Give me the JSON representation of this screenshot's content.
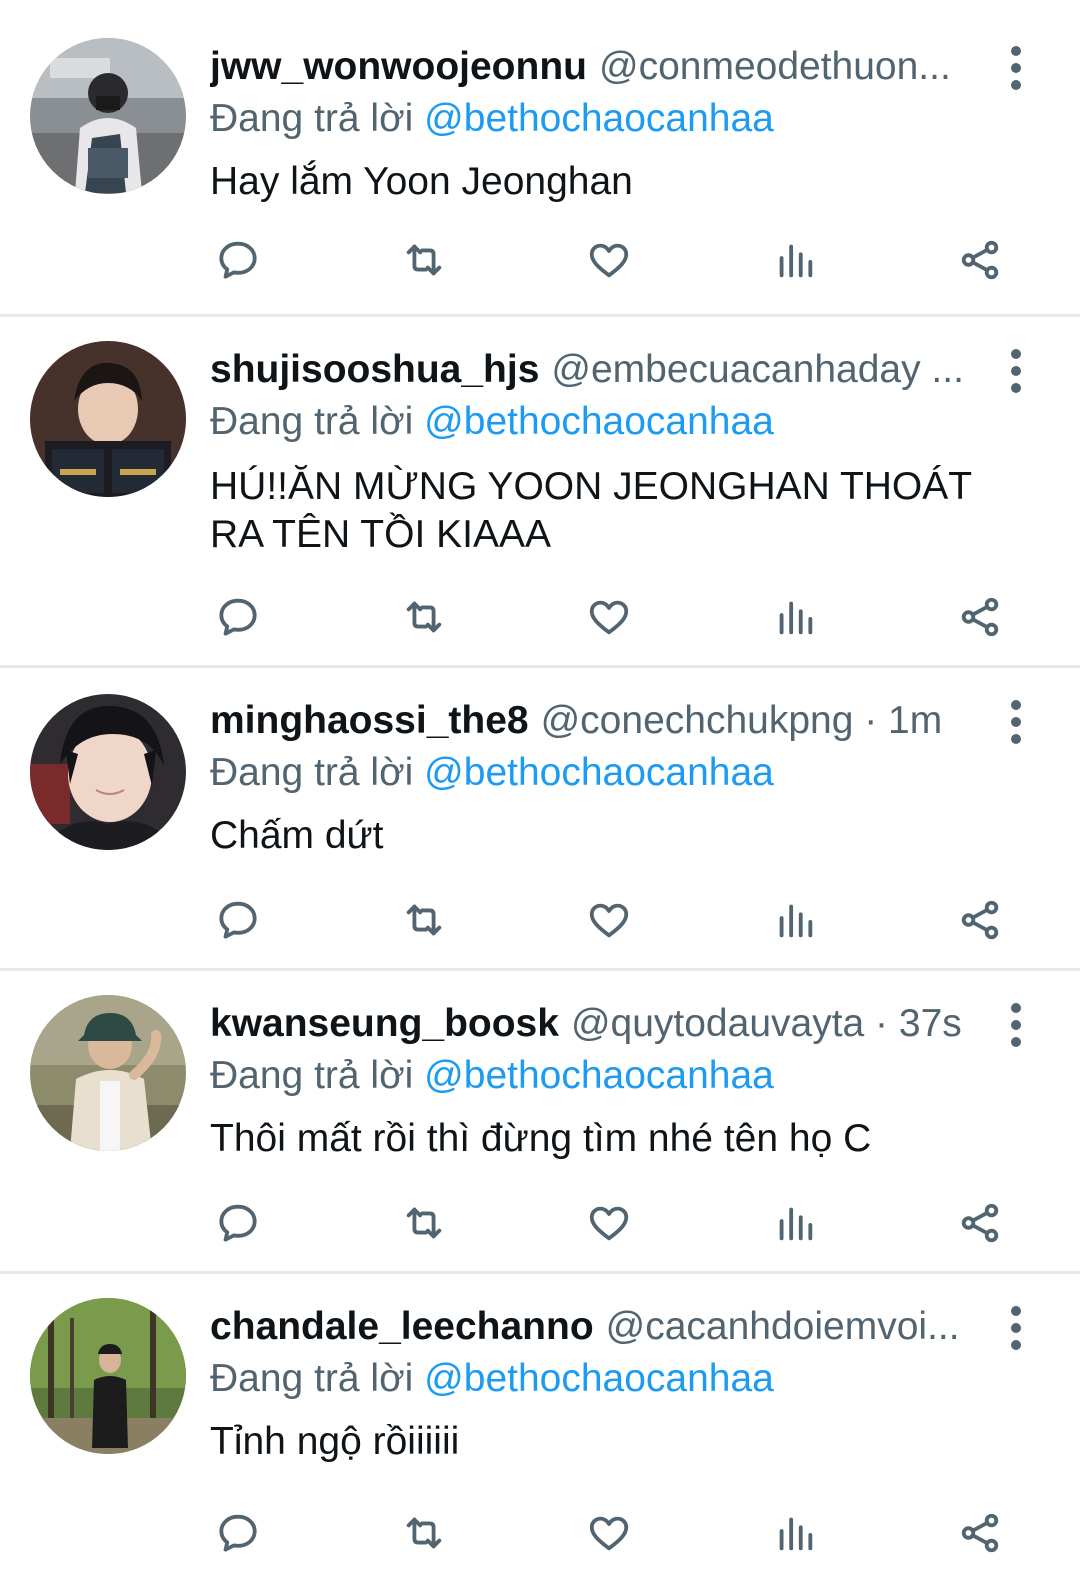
{
  "colors": {
    "text": "#0f1419",
    "secondary": "#536471",
    "accent": "#1d9bf0",
    "divider": "#e6e9ec"
  },
  "tweets": [
    {
      "display_name": "jww_wonwoojeonnu",
      "handle": "@conmeodethuon...",
      "reply_prefix": "Đang trả lời",
      "reply_to": "@bethochaocanhaa",
      "text": "Hay lắm Yoon Jeonghan",
      "avatar": "photo-person-camera"
    },
    {
      "display_name": "shujisooshua_hjs",
      "handle": "@embecuacanhaday ...",
      "reply_prefix": "Đang trả lời",
      "reply_to": "@bethochaocanhaa",
      "text": "HÚ!!ĂN MỪNG YOON JEONGHAN THOÁT RA TÊN TỒI KIAAA",
      "avatar": "photo-person-book"
    },
    {
      "display_name": "minghaossi_the8",
      "handle": "@conechchukpng · 1m",
      "reply_prefix": "Đang trả lời",
      "reply_to": "@bethochaocanhaa",
      "text": "Chấm dứt",
      "avatar": "photo-person-closeup"
    },
    {
      "display_name": "kwanseung_boosk",
      "handle": "@quytodauvayta · 37s",
      "reply_prefix": "Đang trả lời",
      "reply_to": "@bethochaocanhaa",
      "text": "Thôi mất rồi thì đừng tìm nhé tên họ C",
      "avatar": "photo-person-bucket-hat"
    },
    {
      "display_name": "chandale_leechanno",
      "handle": "@cacanhdoiemvoi...",
      "reply_prefix": "Đang trả lời",
      "reply_to": "@bethochaocanhaa",
      "text": "Tỉnh ngộ rồiiiiii",
      "avatar": "photo-person-forest"
    }
  ],
  "action_icons": [
    "reply-icon",
    "retweet-icon",
    "like-icon",
    "views-icon",
    "share-icon"
  ]
}
